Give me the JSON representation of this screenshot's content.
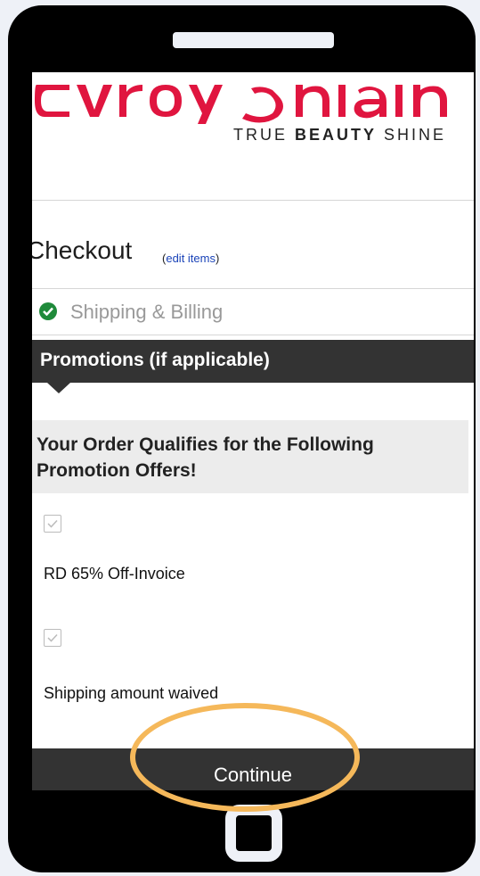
{
  "brand": {
    "logo_text": "Avroy Shlain",
    "tagline_part1": "TRUE",
    "tagline_bold": "BEAUTY",
    "tagline_part2": "SHINE",
    "logo_color": "#e0153f"
  },
  "checkout": {
    "title": "Checkout",
    "edit_open": "(",
    "edit_label": "edit items",
    "edit_close": ")"
  },
  "steps": {
    "shipping_billing": "Shipping & Billing",
    "shipping_billing_status": "complete"
  },
  "promotions": {
    "header": "Promotions (if applicable)",
    "qualify_text": "Your Order Qualifies for the Following Promotion Offers!",
    "offers": [
      {
        "label": "RD 65% Off-Invoice",
        "checked": true
      },
      {
        "label": "Shipping amount waived",
        "checked": true
      }
    ]
  },
  "actions": {
    "continue_label": "Continue"
  },
  "colors": {
    "dark_bar": "#333333",
    "success_green": "#1f8a3a",
    "link_blue": "#1a43b8",
    "highlight_orange": "#f5b85a"
  }
}
